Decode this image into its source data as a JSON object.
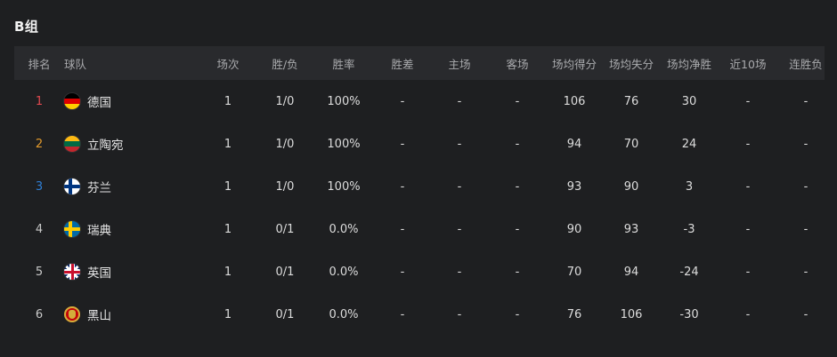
{
  "group_title": "B组",
  "headers": {
    "rank": "排名",
    "team": "球队",
    "gp": "场次",
    "wl": "胜/负",
    "pct": "胜率",
    "gb": "胜差",
    "home": "主场",
    "away": "客场",
    "ppg": "场均得分",
    "oppg": "场均失分",
    "diff": "场均净胜",
    "l10": "近10场",
    "streak": "连胜负"
  },
  "rows": [
    {
      "rank": "1",
      "team": "德国",
      "flag": "germany-flag-icon",
      "gp": "1",
      "wl": "1/0",
      "pct": "100%",
      "gb": "-",
      "home": "-",
      "away": "-",
      "ppg": "106",
      "oppg": "76",
      "diff": "30",
      "l10": "-",
      "streak": "-"
    },
    {
      "rank": "2",
      "team": "立陶宛",
      "flag": "lithuania-flag-icon",
      "gp": "1",
      "wl": "1/0",
      "pct": "100%",
      "gb": "-",
      "home": "-",
      "away": "-",
      "ppg": "94",
      "oppg": "70",
      "diff": "24",
      "l10": "-",
      "streak": "-"
    },
    {
      "rank": "3",
      "team": "芬兰",
      "flag": "finland-flag-icon",
      "gp": "1",
      "wl": "1/0",
      "pct": "100%",
      "gb": "-",
      "home": "-",
      "away": "-",
      "ppg": "93",
      "oppg": "90",
      "diff": "3",
      "l10": "-",
      "streak": "-"
    },
    {
      "rank": "4",
      "team": "瑞典",
      "flag": "sweden-flag-icon",
      "gp": "1",
      "wl": "0/1",
      "pct": "0.0%",
      "gb": "-",
      "home": "-",
      "away": "-",
      "ppg": "90",
      "oppg": "93",
      "diff": "-3",
      "l10": "-",
      "streak": "-"
    },
    {
      "rank": "5",
      "team": "英国",
      "flag": "uk-flag-icon",
      "gp": "1",
      "wl": "0/1",
      "pct": "0.0%",
      "gb": "-",
      "home": "-",
      "away": "-",
      "ppg": "70",
      "oppg": "94",
      "diff": "-24",
      "l10": "-",
      "streak": "-"
    },
    {
      "rank": "6",
      "team": "黑山",
      "flag": "montenegro-flag-icon",
      "gp": "1",
      "wl": "0/1",
      "pct": "0.0%",
      "gb": "-",
      "home": "-",
      "away": "-",
      "ppg": "76",
      "oppg": "106",
      "diff": "-30",
      "l10": "-",
      "streak": "-"
    }
  ],
  "colors": {
    "rank_1": "#e0494f",
    "rank_2": "#e39a2c",
    "rank_3": "#2f7fd6",
    "background": "#1e1f21",
    "header_bg": "#292a2d"
  }
}
